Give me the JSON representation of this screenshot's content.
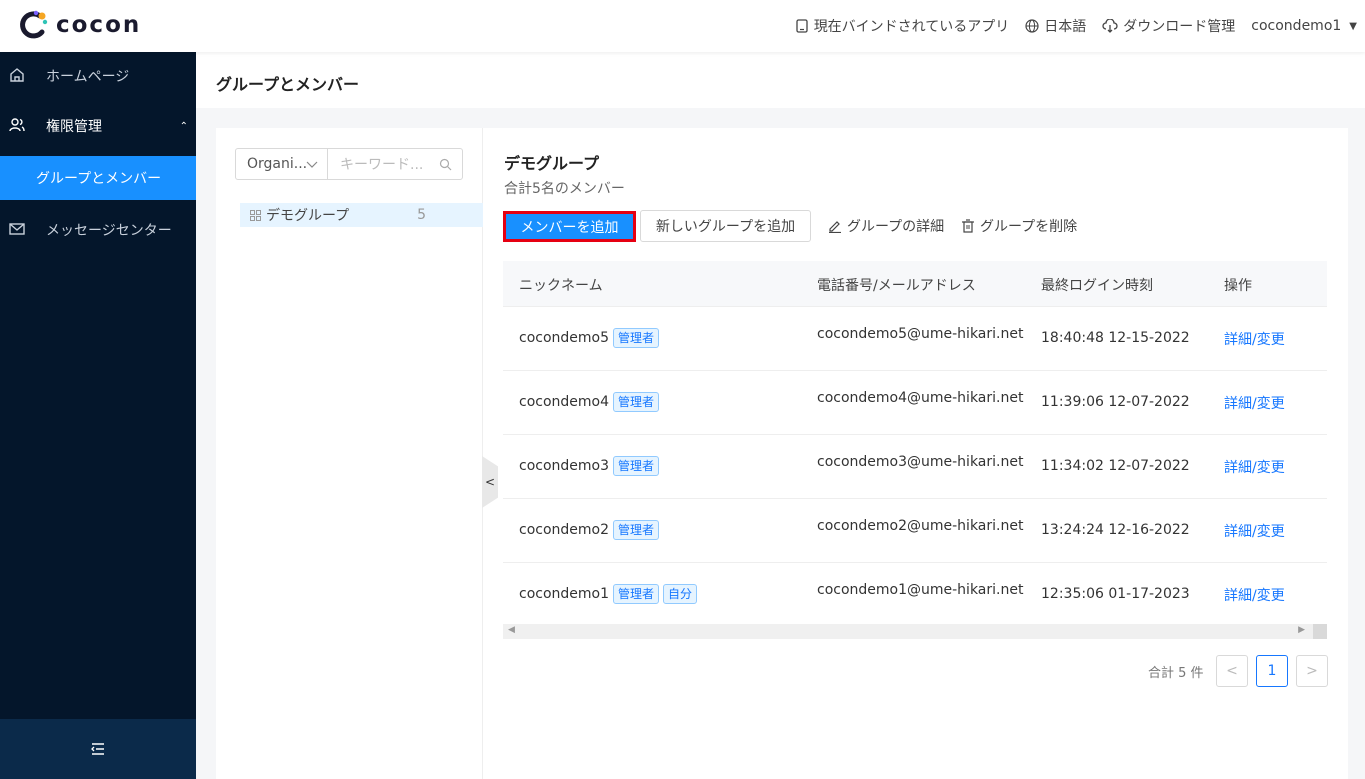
{
  "app": {
    "brand": "cocon"
  },
  "header": {
    "bound_apps": "現在バインドされているアプリ",
    "language": "日本語",
    "downloads": "ダウンロード管理",
    "user": "cocondemo1"
  },
  "sidebar": {
    "home": "ホームページ",
    "permissions": "権限管理",
    "groups_members": "グループとメンバー",
    "messages": "メッセージセンター"
  },
  "page": {
    "title": "グループとメンバー"
  },
  "filter": {
    "org_select": "Organi...",
    "keyword_placeholder": "キーワード..."
  },
  "tree": {
    "node_label": "デモグループ",
    "node_count": "5"
  },
  "group": {
    "name": "デモグループ",
    "summary": "合計5名のメンバー",
    "add_member": "メンバーを追加",
    "add_group": "新しいグループを追加",
    "details": "グループの詳細",
    "delete": "グループを削除"
  },
  "table": {
    "columns": [
      "ニックネーム",
      "電話番号/メールアドレス",
      "最終ログイン時刻",
      "操作"
    ],
    "rows": [
      {
        "nickname": "cocondemo5",
        "tags": [
          "管理者"
        ],
        "contact": "cocondemo5@ume-hikari.net",
        "last_login": "18:40:48 12-15-2022",
        "action": "詳細/変更"
      },
      {
        "nickname": "cocondemo4",
        "tags": [
          "管理者"
        ],
        "contact": "cocondemo4@ume-hikari.net",
        "last_login": "11:39:06 12-07-2022",
        "action": "詳細/変更"
      },
      {
        "nickname": "cocondemo3",
        "tags": [
          "管理者"
        ],
        "contact": "cocondemo3@ume-hikari.net",
        "last_login": "11:34:02 12-07-2022",
        "action": "詳細/変更"
      },
      {
        "nickname": "cocondemo2",
        "tags": [
          "管理者"
        ],
        "contact": "cocondemo2@ume-hikari.net",
        "last_login": "13:24:24 12-16-2022",
        "action": "詳細/変更"
      },
      {
        "nickname": "cocondemo1",
        "tags": [
          "管理者",
          "自分"
        ],
        "contact": "cocondemo1@ume-hikari.net",
        "last_login": "12:35:06 01-17-2023",
        "action": "詳細/変更"
      }
    ]
  },
  "pagination": {
    "total": "合計 5 件",
    "current_page": "1"
  },
  "colors": {
    "primary": "#1890ff",
    "sidebar_bg": "#04162b",
    "highlight_border": "#e60012"
  },
  "icons": [
    "tablet-icon",
    "globe-icon",
    "cloud-download-icon",
    "home-icon",
    "users-icon",
    "mail-icon",
    "search-icon",
    "grid-icon",
    "edit-icon",
    "trash-icon",
    "menu-fold-icon"
  ]
}
